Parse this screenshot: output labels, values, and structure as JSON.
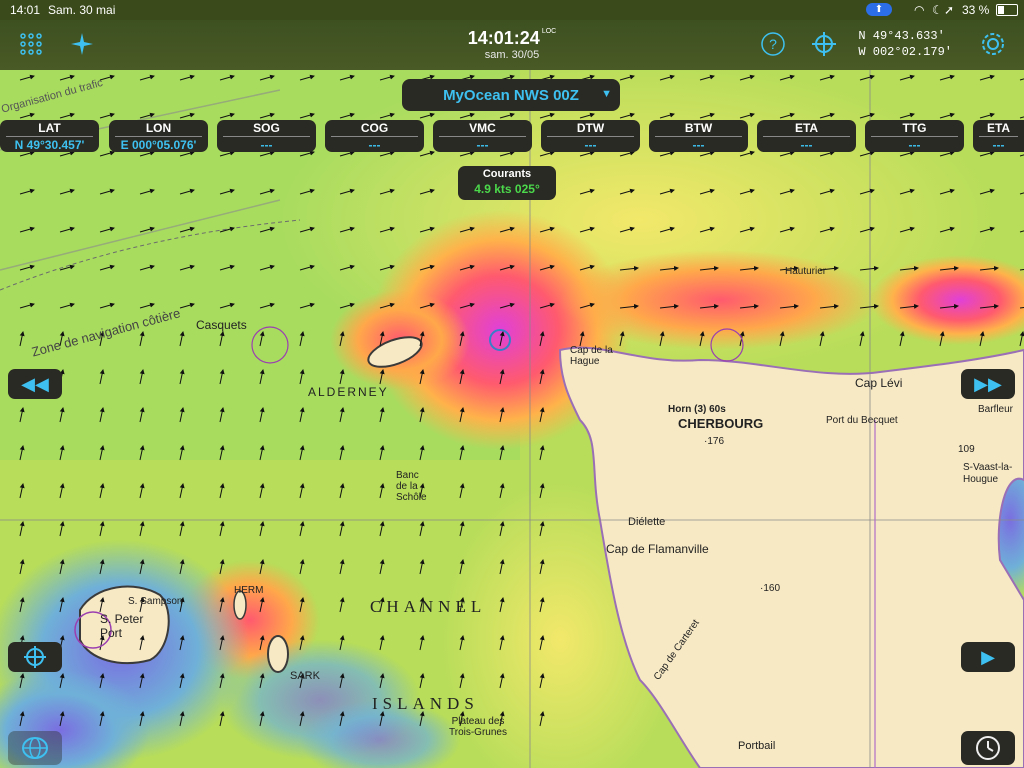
{
  "status": {
    "time": "14:01",
    "date": "Sam. 30 mai",
    "battery": "33 %"
  },
  "topbar": {
    "clock_time": "14:01:24",
    "clock_loc": "LOC",
    "clock_date": "sam. 30/05",
    "pos_lat": "N  49°43.633'",
    "pos_lon": "W 002°02.179'"
  },
  "selector": {
    "label": "MyOcean NWS 00Z"
  },
  "instruments": [
    {
      "label": "LAT",
      "value": "N  49°30.457'"
    },
    {
      "label": "LON",
      "value": "E 000°05.076'"
    },
    {
      "label": "SOG",
      "value": "---"
    },
    {
      "label": "COG",
      "value": "---"
    },
    {
      "label": "VMC",
      "value": "---"
    },
    {
      "label": "DTW",
      "value": "---"
    },
    {
      "label": "BTW",
      "value": "---"
    },
    {
      "label": "ETA",
      "value": "---"
    },
    {
      "label": "TTG",
      "value": "---"
    },
    {
      "label": "ETA",
      "value": "---"
    }
  ],
  "courants": {
    "label": "Courants",
    "value": "4.9 kts 025°"
  },
  "map_labels": {
    "cherbourg": "CHERBOURG",
    "cap_levi": "Cap Lévi",
    "flamanville": "Cap de Flamanville",
    "channel": "CHANNEL",
    "islands": "ISLANDS",
    "alderney": "ALDERNEY",
    "peter_port": "S. Peter Port",
    "sark": "SARK",
    "dielette": "Diélette",
    "portbail": "Portbail",
    "casquets": "Casquets",
    "hauturier": "Hauturier",
    "carteret": "Cap de Carteret",
    "zone": "Zone de navigation côtière",
    "organisation": "Organisation du trafic",
    "hague": "Cap de la Hague",
    "vaast": "S-Vaast-la-Hougue",
    "horn_cherbourg": "Horn (3) 60s",
    "becquet": "Port du Becquet",
    "barfleur": "Barfleur",
    "herm": "HERM",
    "sampson": "S. Sampson",
    "plateau": "Plateau des Trois-Grunes",
    "sehole": "Banc de la Schôle",
    "val_176": "·176",
    "val_160": "·160",
    "val_109": "109"
  }
}
